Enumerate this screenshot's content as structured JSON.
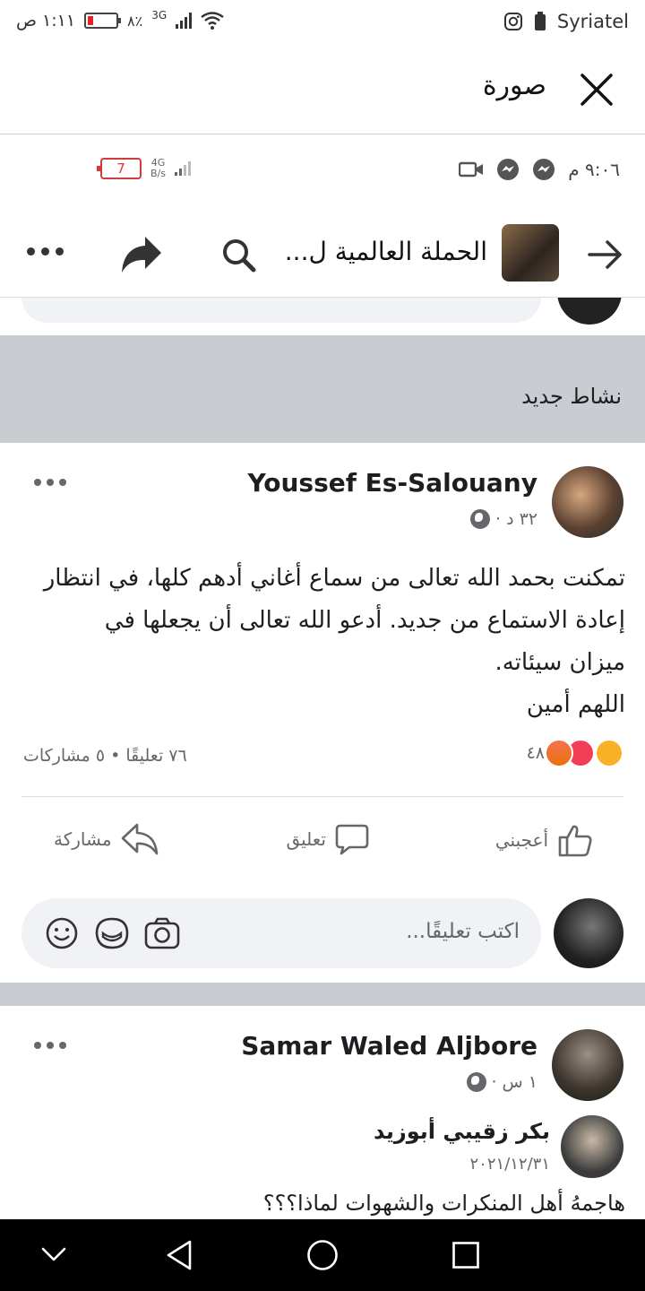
{
  "status_bar": {
    "time": "١:١١ ص",
    "battery_pct": "٨٪",
    "network": "3G",
    "carrier": "Syriatel"
  },
  "viewer": {
    "title": "صورة"
  },
  "screenshot": {
    "inner_status": {
      "time": "٩:٠٦ م",
      "battery": "7",
      "speed": "B/s",
      "network": "4G"
    },
    "page_bar": {
      "page_name": "الحملة العالمية ل..."
    },
    "activity_label": "نشاط جديد",
    "post1": {
      "author": "Youssef Es-Salouany",
      "time": "٣٢ د",
      "text_lines": [
        "تمكنت بحمد الله تعالى من سماع أغاني أدهم كلها، في انتظار",
        "إعادة الاستماع من جديد. أدعو الله تعالى أن يجعلها في",
        "ميزان سيئاته.",
        "اللهم أمين"
      ],
      "reactions_count": "٤٨",
      "comments_shares": "٧٦ تعليقًا • ٥ مشاركات",
      "actions": {
        "like": "أعجبني",
        "comment": "تعليق",
        "share": "مشاركة"
      },
      "comment_placeholder": "اكتب تعليقًا..."
    },
    "post2": {
      "author": "Samar Waled Aljbore",
      "time": "١ س",
      "shared_author": "بكر زقيبي أبوزيد",
      "shared_date": "٢٠٢١/١٢/٣١",
      "shared_text": "هاجمهُ أهل المنكرات والشهوات لماذا؟؟؟"
    }
  },
  "colors": {
    "fb_gray": "#65676b",
    "band": "#c9ccd1",
    "battery_red": "#d23b3b"
  }
}
